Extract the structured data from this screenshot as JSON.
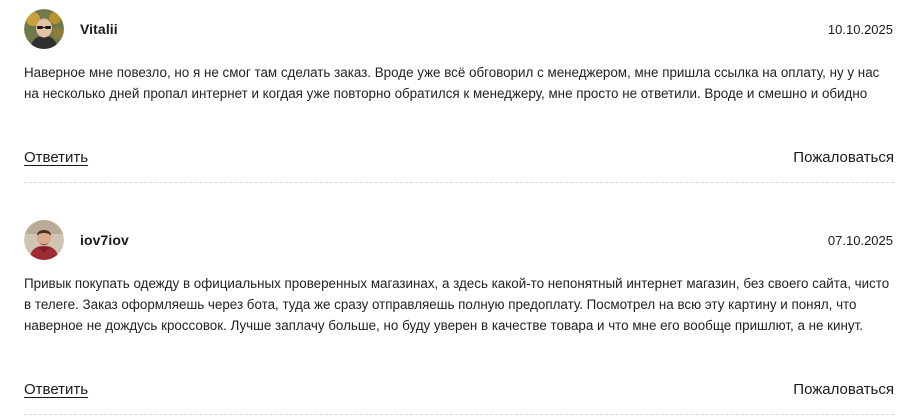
{
  "comments": [
    {
      "author": "Vitalii",
      "date": "10.10.2025",
      "text": "Наверное мне повезло, но я не смог там сделать заказ. Вроде уже всё обговорил с менеджером, мне пришла ссылка на оплату, ну у нас на несколько дней пропал интернет и когдая уже повторно обратился к менеджеру, мне просто не ответили. Вроде и смешно и обидно",
      "reply_label": "Ответить",
      "report_label": "Пожаловаться",
      "avatar_icon": "user-photo-avatar"
    },
    {
      "author": "iov7iov",
      "date": "07.10.2025",
      "text": "Привык покупать одежду в официальных проверенных магазинах, а здесь какой-то непонятный интернет магазин, без своего сайта, чисто в телеге. Заказ оформляешь через бота, туда же сразу отправляешь полную предоплату. Посмотрел на всю эту картину и понял, что наверное не дождусь кроссовок. Лучше заплачу больше, но буду уверен в качестве товара и что мне его вообще пришлют, а не кинут.",
      "reply_label": "Ответить",
      "report_label": "Пожаловаться",
      "avatar_icon": "user-photo-avatar"
    }
  ],
  "colors": {
    "text": "#222222",
    "divider": "#d6d6d6"
  }
}
